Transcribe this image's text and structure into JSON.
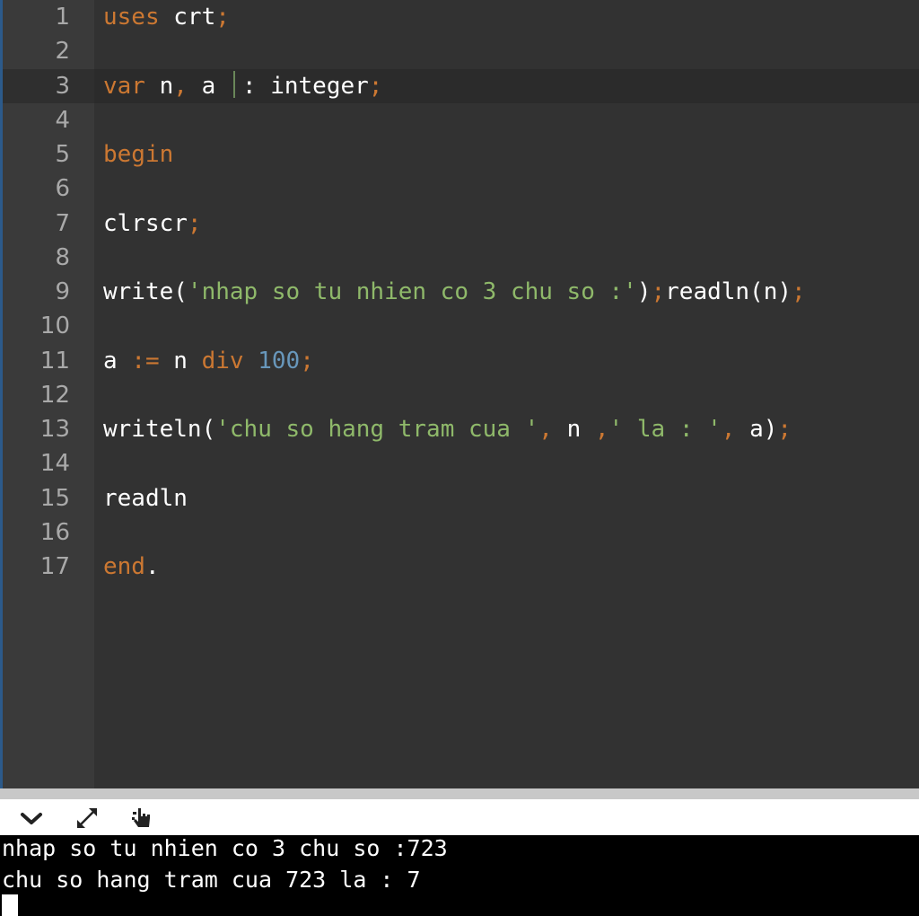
{
  "editor": {
    "active_line": 3,
    "lines": [
      {
        "n": "1",
        "tokens": [
          [
            "kw",
            "uses"
          ],
          [
            "id",
            " crt"
          ],
          [
            "op",
            ";"
          ]
        ]
      },
      {
        "n": "2",
        "tokens": []
      },
      {
        "n": "3",
        "tokens": [
          [
            "kw",
            "var"
          ],
          [
            "id",
            " n"
          ],
          [
            "op",
            ","
          ],
          [
            "id",
            " a "
          ],
          [
            "caret",
            ""
          ],
          [
            "id",
            ": integer"
          ],
          [
            "op",
            ";"
          ]
        ]
      },
      {
        "n": "4",
        "tokens": []
      },
      {
        "n": "5",
        "tokens": [
          [
            "kw",
            "begin"
          ]
        ]
      },
      {
        "n": "6",
        "tokens": []
      },
      {
        "n": "7",
        "tokens": [
          [
            "id",
            "clrscr"
          ],
          [
            "op",
            ";"
          ]
        ]
      },
      {
        "n": "8",
        "tokens": []
      },
      {
        "n": "9",
        "tokens": [
          [
            "id",
            "write("
          ],
          [
            "str",
            "'nhap so tu nhien co 3 chu so :'"
          ],
          [
            "id",
            ")"
          ],
          [
            "op",
            ";"
          ],
          [
            "id",
            "readln(n)"
          ],
          [
            "op",
            ";"
          ]
        ]
      },
      {
        "n": "10",
        "tokens": []
      },
      {
        "n": "11",
        "tokens": [
          [
            "id",
            "a "
          ],
          [
            "op",
            ":="
          ],
          [
            "id",
            " n "
          ],
          [
            "kw",
            "div"
          ],
          [
            "id",
            " "
          ],
          [
            "num",
            "100"
          ],
          [
            "op",
            ";"
          ]
        ]
      },
      {
        "n": "12",
        "tokens": []
      },
      {
        "n": "13",
        "tokens": [
          [
            "id",
            "writeln("
          ],
          [
            "str",
            "'chu so hang tram cua '"
          ],
          [
            "op",
            ","
          ],
          [
            "id",
            " n "
          ],
          [
            "op",
            ","
          ],
          [
            "str",
            "' la : '"
          ],
          [
            "op",
            ","
          ],
          [
            "id",
            " a)"
          ],
          [
            "op",
            ";"
          ]
        ]
      },
      {
        "n": "14",
        "tokens": []
      },
      {
        "n": "15",
        "tokens": [
          [
            "id",
            "readln"
          ]
        ]
      },
      {
        "n": "16",
        "tokens": []
      },
      {
        "n": "17",
        "tokens": [
          [
            "kw",
            "end"
          ],
          [
            "id",
            "."
          ]
        ]
      }
    ]
  },
  "toolbar": {
    "buttons": [
      {
        "name": "collapse-button",
        "icon": "chevron-down-icon"
      },
      {
        "name": "expand-button",
        "icon": "expand-arrows-icon"
      },
      {
        "name": "input-button",
        "icon": "hand-cursor-icon"
      }
    ]
  },
  "console": {
    "lines": [
      "nhap so tu nhien co 3 chu so :723",
      "chu so hang tram cua 723 la : 7"
    ]
  },
  "colors": {
    "editor_bg": "#323232",
    "gutter_bg": "#3a3a3a",
    "keyword": "#cc7832",
    "string": "#8fb96a",
    "number": "#6897bb",
    "console_bg": "#000000"
  }
}
